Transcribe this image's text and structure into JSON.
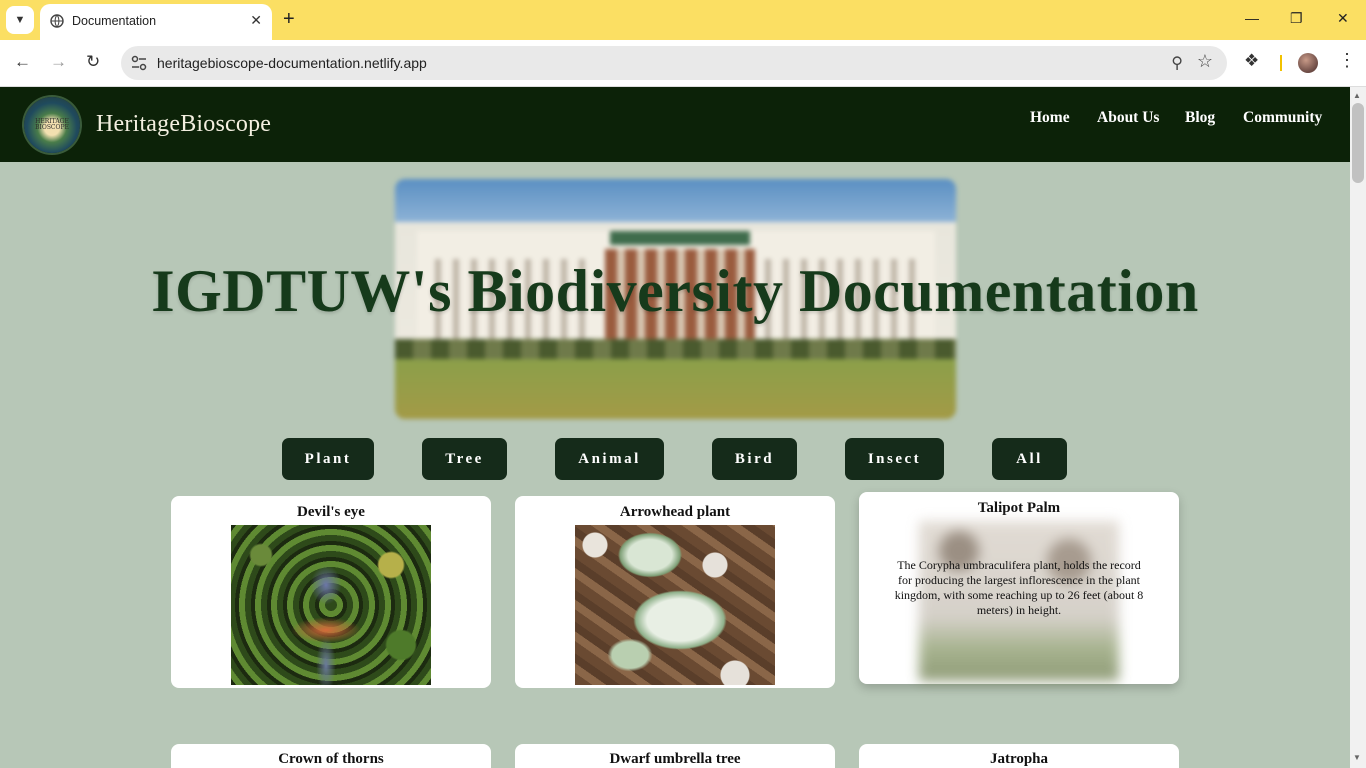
{
  "browser": {
    "tab_title": "Documentation",
    "url": "heritagebioscope-documentation.netlify.app"
  },
  "site": {
    "brand": "HeritageBioscope",
    "logo_text": "HERITAGE BIOSCOPE",
    "nav": [
      "Home",
      "About Us",
      "Blog",
      "Community"
    ]
  },
  "hero": {
    "headline": "IGDTUW's Biodiversity Documentation"
  },
  "filters": [
    "Plant",
    "Tree",
    "Animal",
    "Bird",
    "Insect",
    "All"
  ],
  "cards": [
    {
      "name": "Devil's eye",
      "image": "buddha-statue-among-plants"
    },
    {
      "name": "Arrowhead plant",
      "image": "arrowhead-leaves-on-soil"
    },
    {
      "name": "Talipot Palm",
      "image": "talipot-palm-blurred",
      "description": "The Corypha umbraculifera plant, holds the record for producing the largest inflorescence in the plant kingdom, with some reaching up to 26 feet (about 8 meters) in height."
    }
  ],
  "cards_row2": [
    "Crown of thorns",
    "Dwarf umbrella tree",
    "Jatropha"
  ],
  "colors": {
    "tab_strip": "#fbdf63",
    "site_nav": "#0c2208",
    "page_bg": "#b7c7b7",
    "headline": "#163a1b",
    "filter_button": "#152b1a"
  }
}
